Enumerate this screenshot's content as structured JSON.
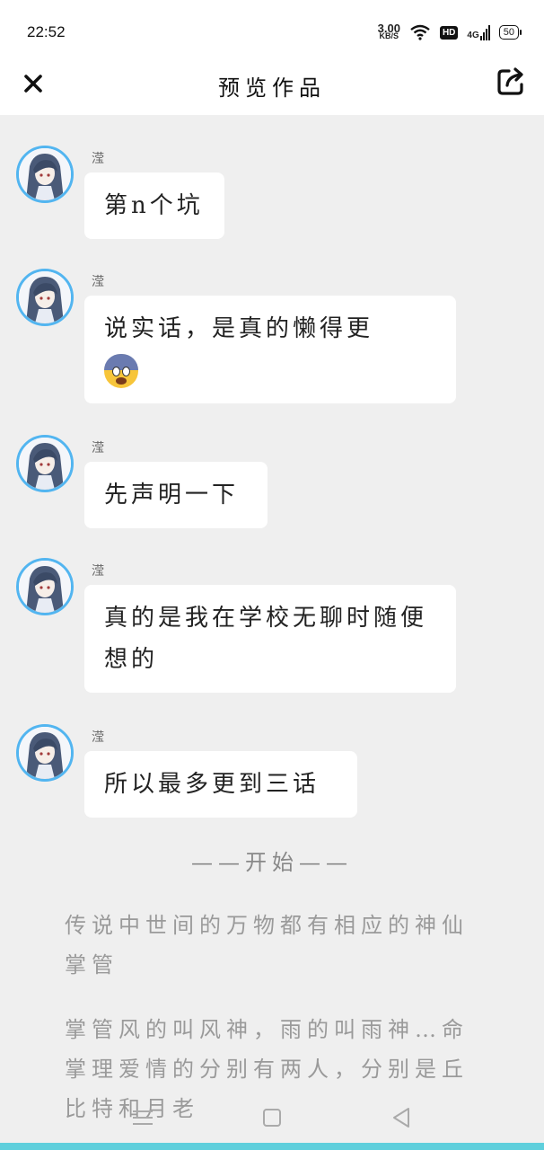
{
  "status_bar": {
    "time": "22:52",
    "net_speed_value": "3.00",
    "net_speed_unit": "KB/S",
    "hd_label": "HD",
    "network_label": "4G",
    "battery": "50"
  },
  "header": {
    "title": "预览作品"
  },
  "messages": [
    {
      "author": "滢",
      "text": "第n个坑"
    },
    {
      "author": "滢",
      "text": "说实话，是真的懒得更",
      "emoji": "fearful-face"
    },
    {
      "author": "滢",
      "text": "先声明一下"
    },
    {
      "author": "滢",
      "text": "真的是我在学校无聊时随便想的"
    },
    {
      "author": "滢",
      "text": "所以最多更到三话"
    }
  ],
  "story": {
    "divider": "——开始——",
    "paragraphs": [
      "传说中世间的万物都有相应的神仙掌管",
      "掌管风的叫风神，雨的叫雨神…命掌理爱情的分别有两人，分别是丘比特和月老"
    ]
  },
  "icons": {
    "close": "close-icon",
    "share": "share-icon",
    "nav_menu": "menu-icon",
    "nav_home": "home-square-icon",
    "nav_back": "back-triangle-icon"
  },
  "colors": {
    "avatar_ring": "#52b5f0",
    "bottom_strip": "#5ecfdc",
    "background": "#efefef"
  }
}
